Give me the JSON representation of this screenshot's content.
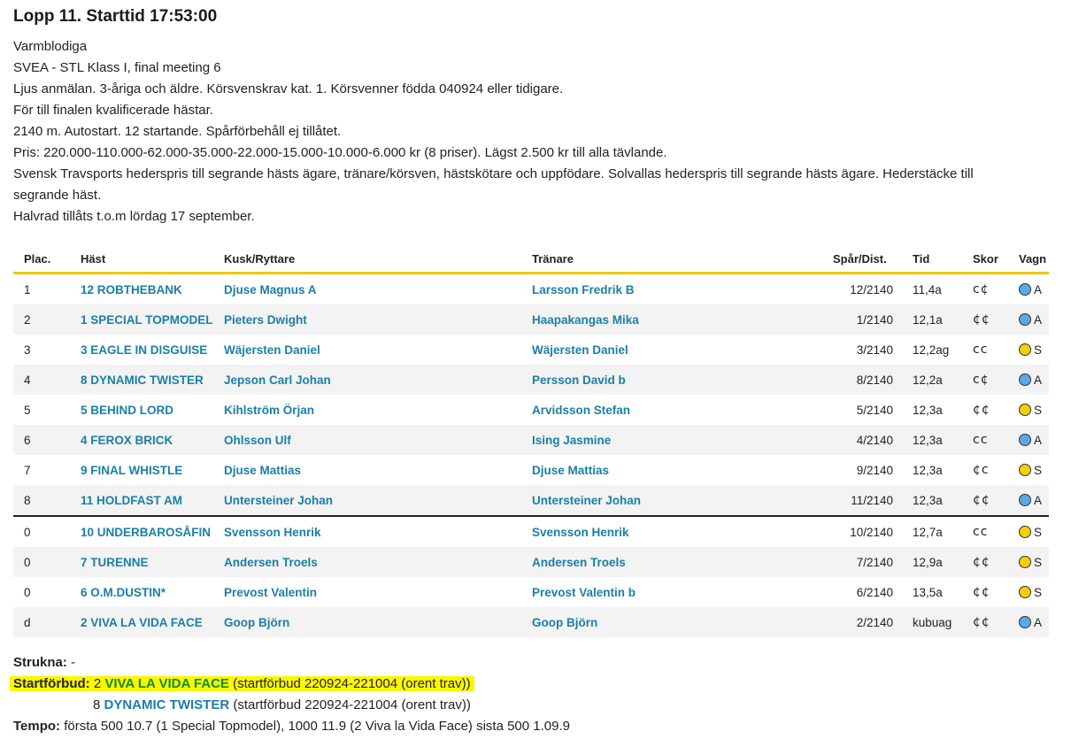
{
  "race": {
    "title": "Lopp 11. Starttid 17:53:00",
    "lines": [
      "Varmblodiga",
      "SVEA - STL Klass I, final meeting 6",
      "Ljus anmälan. 3-åriga och äldre. Körsvenskrav kat. 1. Körsvenner födda 040924 eller tidigare.",
      "För till finalen kvalificerade hästar.",
      "2140 m. Autostart. 12 startande. Spårförbehåll ej tillåtet.",
      "Pris: 220.000-110.000-62.000-35.000-22.000-15.000-10.000-6.000 kr (8 priser). Lägst 2.500 kr till alla tävlande.",
      "Svensk Travsports hederspris till segrande hästs ägare, tränare/körsven, hästskötare och uppfödare. Solvallas hederspris till segrande hästs ägare. Hederstäcke till segrande häst.",
      "Halvrad tillåts t.o.m lördag 17 september."
    ]
  },
  "table": {
    "headers": {
      "plac": "Plac.",
      "hast": "Häst",
      "kusk": "Kusk/Ryttare",
      "tranare": "Tränare",
      "spar": "Spår/Dist.",
      "tid": "Tid",
      "skor": "Skor",
      "vagn": "Vagn"
    },
    "colors": {
      "yellow": "#f5cf00",
      "blue": "#5aa9e6"
    },
    "rows": [
      {
        "plac": "1",
        "hast": "12 ROBTHEBANK",
        "kusk": "Djuse Magnus A",
        "tranare": "Larsson Fredrik B",
        "spar": "12/2140",
        "tid": "11,4a",
        "skor": "c¢",
        "vagn": "A",
        "color": "blue"
      },
      {
        "plac": "2",
        "hast": "1 SPECIAL TOPMODEL",
        "kusk": "Pieters Dwight",
        "tranare": "Haapakangas Mika",
        "spar": "1/2140",
        "tid": "12,1a",
        "skor": "¢¢",
        "vagn": "A",
        "color": "blue"
      },
      {
        "plac": "3",
        "hast": "3 EAGLE IN DISGUISE",
        "kusk": "Wäjersten Daniel",
        "tranare": "Wäjersten Daniel",
        "spar": "3/2140",
        "tid": "12,2ag",
        "skor": "cc",
        "vagn": "S",
        "color": "yellow"
      },
      {
        "plac": "4",
        "hast": "8 DYNAMIC TWISTER",
        "kusk": "Jepson Carl Johan",
        "tranare": "Persson David b",
        "spar": "8/2140",
        "tid": "12,2a",
        "skor": "c¢",
        "vagn": "A",
        "color": "blue"
      },
      {
        "plac": "5",
        "hast": "5 BEHIND LORD",
        "kusk": "Kihlström Örjan",
        "tranare": "Arvidsson Stefan",
        "spar": "5/2140",
        "tid": "12,3a",
        "skor": "¢¢",
        "vagn": "S",
        "color": "yellow"
      },
      {
        "plac": "6",
        "hast": "4 FEROX BRICK",
        "kusk": "Ohlsson Ulf",
        "tranare": "Ising Jasmine",
        "spar": "4/2140",
        "tid": "12,3a",
        "skor": "cc",
        "vagn": "A",
        "color": "blue"
      },
      {
        "plac": "7",
        "hast": "9 FINAL WHISTLE",
        "kusk": "Djuse Mattias",
        "tranare": "Djuse Mattias",
        "spar": "9/2140",
        "tid": "12,3a",
        "skor": "¢c",
        "vagn": "S",
        "color": "yellow"
      },
      {
        "plac": "8",
        "hast": "11 HOLDFAST AM",
        "kusk": "Untersteiner Johan",
        "tranare": "Untersteiner Johan",
        "spar": "11/2140",
        "tid": "12,3a",
        "skor": "¢¢",
        "vagn": "A",
        "color": "blue"
      },
      {
        "plac": "0",
        "hast": "10 UNDERBAROSÅFIN",
        "kusk": "Svensson Henrik",
        "tranare": "Svensson Henrik",
        "spar": "10/2140",
        "tid": "12,7a",
        "skor": "cc",
        "vagn": "S",
        "color": "yellow"
      },
      {
        "plac": "0",
        "hast": "7 TURENNE",
        "kusk": "Andersen Troels",
        "tranare": "Andersen Troels",
        "spar": "7/2140",
        "tid": "12,9a",
        "skor": "¢¢",
        "vagn": "S",
        "color": "yellow"
      },
      {
        "plac": "0",
        "hast": "6 O.M.DUSTIN*",
        "kusk": "Prevost Valentin",
        "tranare": "Prevost Valentin b",
        "spar": "6/2140",
        "tid": "13,5a",
        "skor": "¢¢",
        "vagn": "S",
        "color": "yellow"
      },
      {
        "plac": "d",
        "hast": "2 VIVA LA VIDA FACE",
        "kusk": "Goop Björn",
        "tranare": "Goop Björn",
        "spar": "2/2140",
        "tid": "kubuag",
        "skor": "¢¢",
        "vagn": "A",
        "color": "blue"
      }
    ]
  },
  "footer": {
    "strukna_label": "Strukna:",
    "strukna_value": "-",
    "startforbud_label": "Startförbud:",
    "startforbud": [
      {
        "num": "2",
        "horse": "VIVA LA VIDA FACE",
        "note": "(startförbud 220924-221004 (orent trav))"
      },
      {
        "num": "8",
        "horse": "DYNAMIC TWISTER",
        "note": "(startförbud 220924-221004 (orent trav))"
      }
    ],
    "tempo_label": "Tempo:",
    "tempo_value": "första 500 10.7 (1 Special Topmodel), 1000 11.9 (2 Viva la Vida Face) sista 500 1.09.9"
  }
}
